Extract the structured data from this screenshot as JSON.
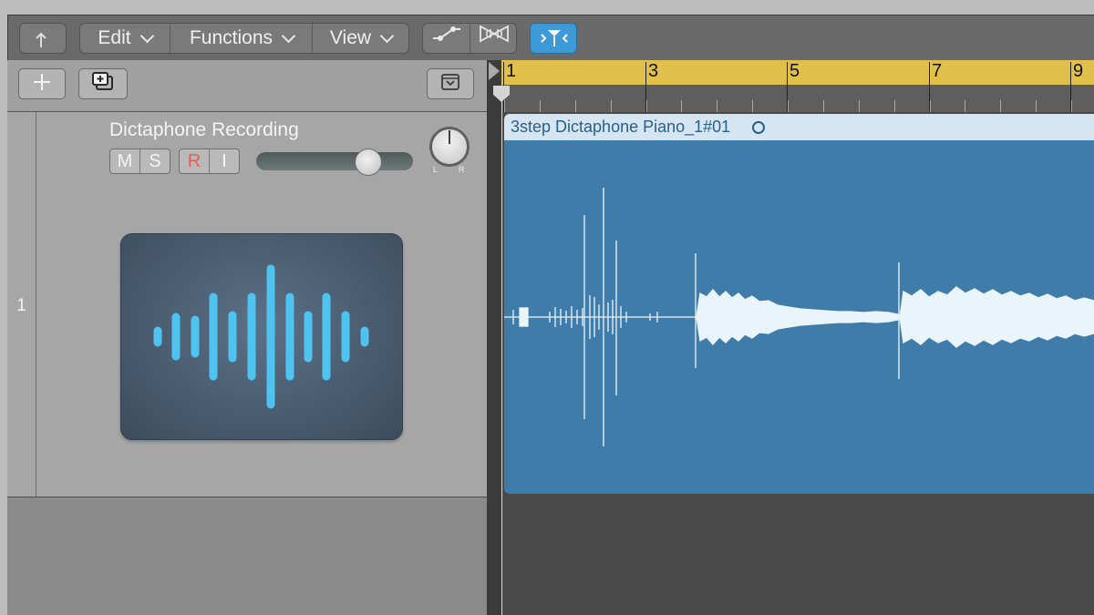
{
  "toolbar": {
    "back_icon": "back-arrow-icon",
    "edit_label": "Edit",
    "functions_label": "Functions",
    "view_label": "View",
    "automation_icon": "automation-curve-icon",
    "flex_icon": "flex-time-icon",
    "catch_icon": "catch-playhead-icon",
    "catch_active_color": "#3d9ad6"
  },
  "header": {
    "add_track_icon": "plus-icon",
    "duplicate_track_icon": "duplicate-track-icon",
    "global_tracks_icon": "chevron-box-icon"
  },
  "track": {
    "number": "1",
    "name": "Dictaphone Recording",
    "mute_label": "M",
    "solo_label": "S",
    "record_label": "R",
    "input_label": "I",
    "record_color": "#e0605a",
    "volume_level": 0.7,
    "pan_left_label": "L",
    "pan_right_label": "R",
    "icon": "waveform-icon"
  },
  "ruler": {
    "bars": [
      "1",
      "3",
      "5",
      "7",
      "9"
    ],
    "cycle_color": "#e0c04a"
  },
  "region": {
    "name": "3step Dictaphone Piano_1#01",
    "loop_icon": "loop-circle-icon",
    "color": "#3f7caa",
    "header_color": "#d5e5f2"
  }
}
